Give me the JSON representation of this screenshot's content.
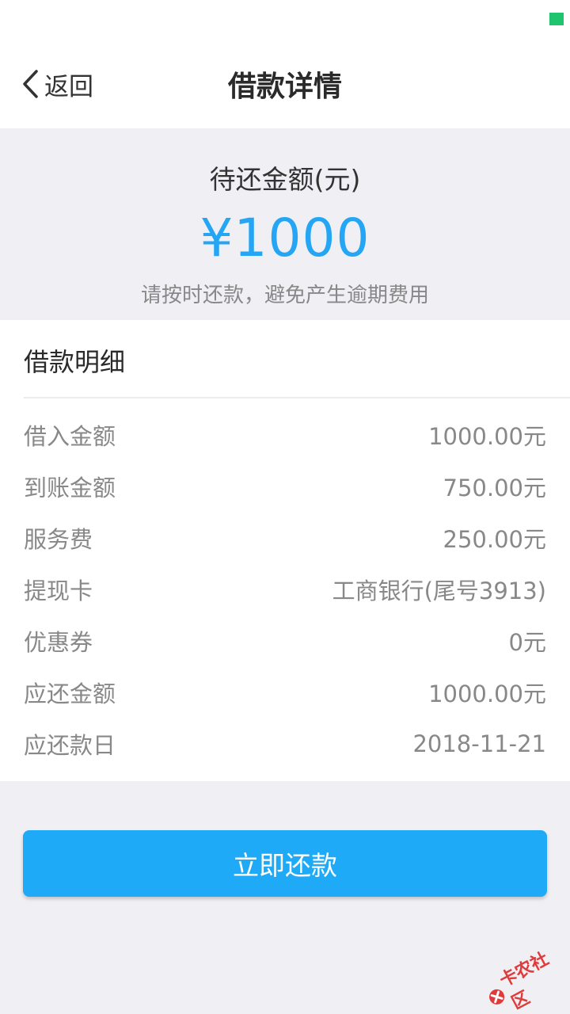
{
  "header": {
    "back_label": "返回",
    "title": "借款详情"
  },
  "summary": {
    "title": "待还金额(元)",
    "amount": "¥1000",
    "tip": "请按时还款，避免产生逾期费用"
  },
  "details": {
    "title": "借款明细",
    "rows": [
      {
        "label": "借入金额",
        "value": "1000.00元"
      },
      {
        "label": "到账金额",
        "value": "750.00元"
      },
      {
        "label": "服务费",
        "value": "250.00元"
      },
      {
        "label": "提现卡",
        "value": "工商银行(尾号3913)"
      },
      {
        "label": "优惠券",
        "value": "0元"
      },
      {
        "label": "应还金额",
        "value": "1000.00元"
      },
      {
        "label": "应还款日",
        "value": "2018-11-21"
      }
    ]
  },
  "actions": {
    "repay_label": "立即还款"
  },
  "watermark": {
    "text": "卡农社区"
  },
  "colors": {
    "accent": "#25a6f4",
    "button": "#1eaaf7",
    "background": "#efeff4",
    "status_indicator": "#1ec46e"
  },
  "icons": {
    "back": "chevron-left-icon",
    "status": "signal-indicator-icon"
  }
}
